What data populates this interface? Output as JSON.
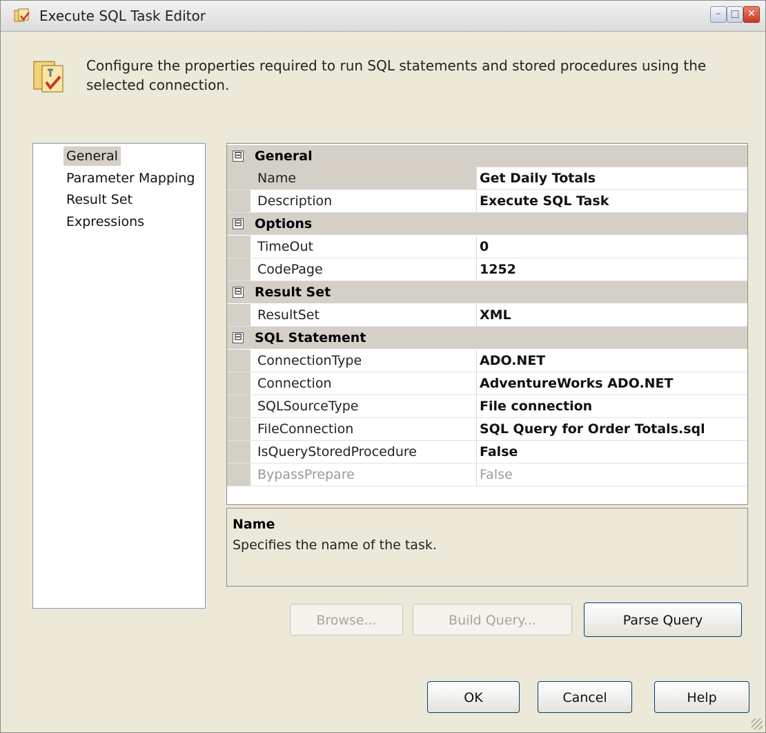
{
  "window": {
    "title": "Execute SQL Task Editor",
    "controls": {
      "minimize": "–",
      "maximize": "□",
      "close": "✕"
    }
  },
  "header": {
    "description": "Configure the properties required to run SQL statements and stored procedures using the selected connection."
  },
  "nav": {
    "items": [
      {
        "label": "General",
        "selected": true
      },
      {
        "label": "Parameter Mapping",
        "selected": false
      },
      {
        "label": "Result Set",
        "selected": false
      },
      {
        "label": "Expressions",
        "selected": false
      }
    ]
  },
  "grid": {
    "toggle": "⊟",
    "categories": {
      "general": "General",
      "options": "Options",
      "result_set": "Result Set",
      "sql_statement": "SQL Statement"
    },
    "rows": {
      "name": {
        "label": "Name",
        "value": "Get Daily Totals"
      },
      "description": {
        "label": "Description",
        "value": "Execute SQL Task"
      },
      "timeout": {
        "label": "TimeOut",
        "value": "0"
      },
      "codepage": {
        "label": "CodePage",
        "value": "1252"
      },
      "resultset": {
        "label": "ResultSet",
        "value": "XML"
      },
      "connectiontype": {
        "label": "ConnectionType",
        "value": "ADO.NET"
      },
      "connection": {
        "label": "Connection",
        "value": "AdventureWorks ADO.NET"
      },
      "sqlsourcetype": {
        "label": "SQLSourceType",
        "value": "File connection"
      },
      "fileconnection": {
        "label": "FileConnection",
        "value": "SQL Query for Order Totals.sql"
      },
      "isquerystoredprocedure": {
        "label": "IsQueryStoredProcedure",
        "value": "False"
      },
      "bypassprepare": {
        "label": "BypassPrepare",
        "value": "False"
      }
    }
  },
  "description_pane": {
    "title": "Name",
    "text": "Specifies the name of the task."
  },
  "buttons": {
    "browse": "Browse...",
    "build_query": "Build Query...",
    "parse_query": "Parse Query",
    "ok": "OK",
    "cancel": "Cancel",
    "help": "Help"
  },
  "colors": {
    "window_bg": "#ece9d8",
    "category_bg": "#d4d0c8",
    "button_border": "#003c74"
  }
}
